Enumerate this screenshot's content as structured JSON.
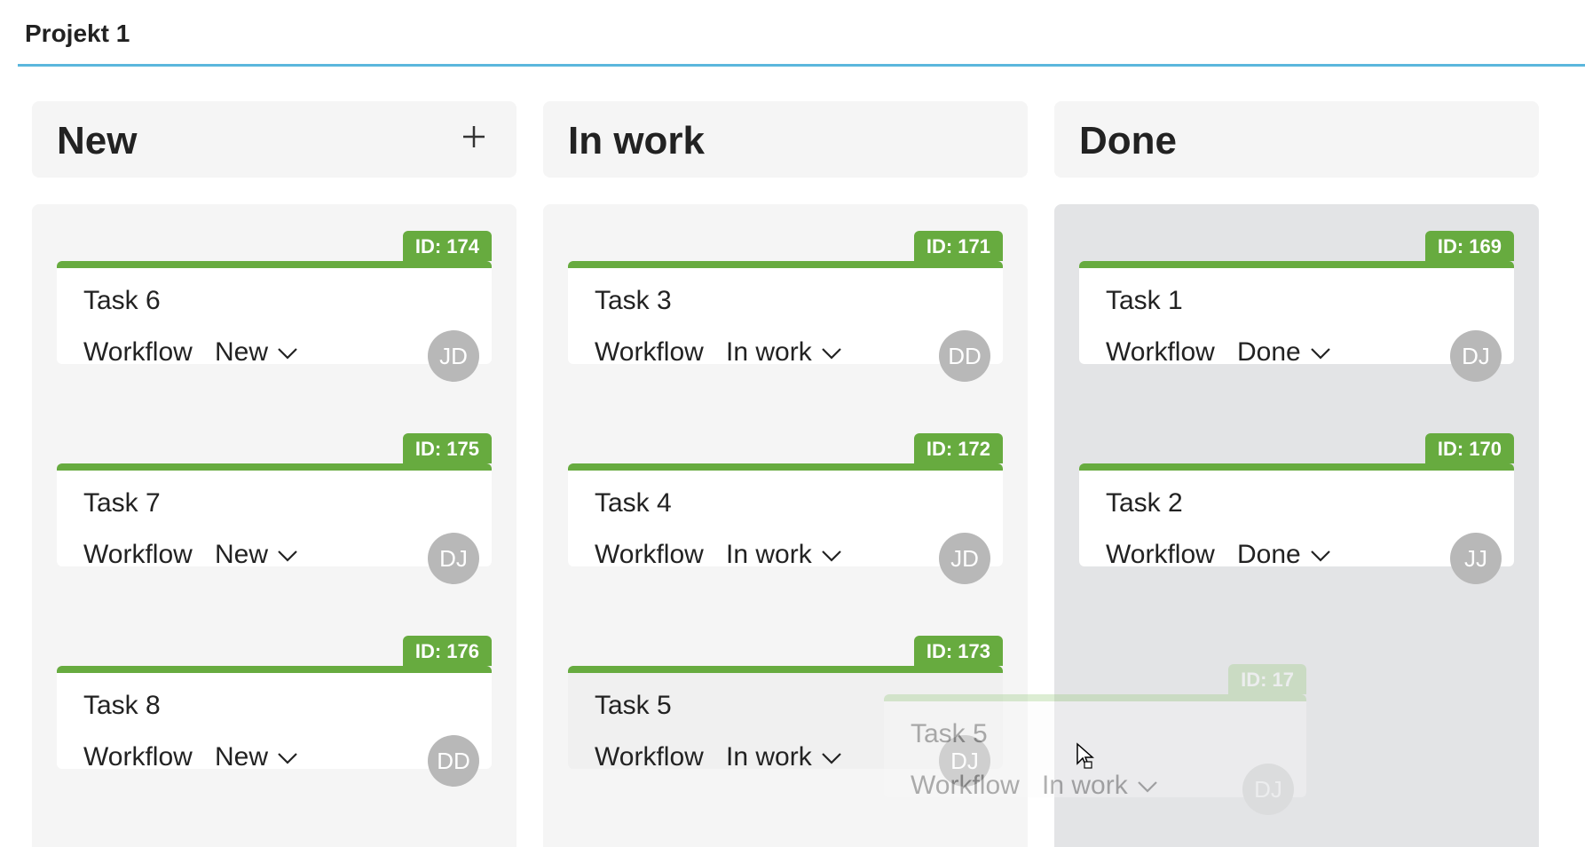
{
  "tab": {
    "label": "Projekt 1"
  },
  "columns": [
    {
      "title": "New",
      "cards": [
        {
          "id": "ID: 174",
          "title": "Task 6",
          "workflow_label": "Workflow",
          "status": "New",
          "assignee": "JD"
        },
        {
          "id": "ID: 175",
          "title": "Task 7",
          "workflow_label": "Workflow",
          "status": "New",
          "assignee": "DJ"
        },
        {
          "id": "ID: 176",
          "title": "Task 8",
          "workflow_label": "Workflow",
          "status": "New",
          "assignee": "DD"
        }
      ]
    },
    {
      "title": "In work",
      "cards": [
        {
          "id": "ID: 171",
          "title": "Task 3",
          "workflow_label": "Workflow",
          "status": "In work",
          "assignee": "DD"
        },
        {
          "id": "ID: 172",
          "title": "Task 4",
          "workflow_label": "Workflow",
          "status": "In work",
          "assignee": "JD"
        },
        {
          "id": "ID: 173",
          "title": "Task 5",
          "workflow_label": "Workflow",
          "status": "In work",
          "assignee": "DJ"
        }
      ]
    },
    {
      "title": "Done",
      "cards": [
        {
          "id": "ID: 169",
          "title": "Task 1",
          "workflow_label": "Workflow",
          "status": "Done",
          "assignee": "DJ"
        },
        {
          "id": "ID: 170",
          "title": "Task 2",
          "workflow_label": "Workflow",
          "status": "Done",
          "assignee": "JJ"
        }
      ]
    }
  ],
  "drag_ghost": {
    "id": "ID: 17",
    "title": "Task 5",
    "workflow_label": "Workflow",
    "status": "In work",
    "assignee": "DJ"
  },
  "colors": {
    "accent": "#67ab3f",
    "tab_underline": "#5bb7dd",
    "column_bg": "#f5f5f5",
    "drop_target_bg": "#e3e4e6",
    "avatar_bg": "#b8b8b8"
  },
  "icons": {
    "add": "plus-icon",
    "dropdown": "chevron-down-icon",
    "cursor": "mouse-pointer-icon"
  }
}
